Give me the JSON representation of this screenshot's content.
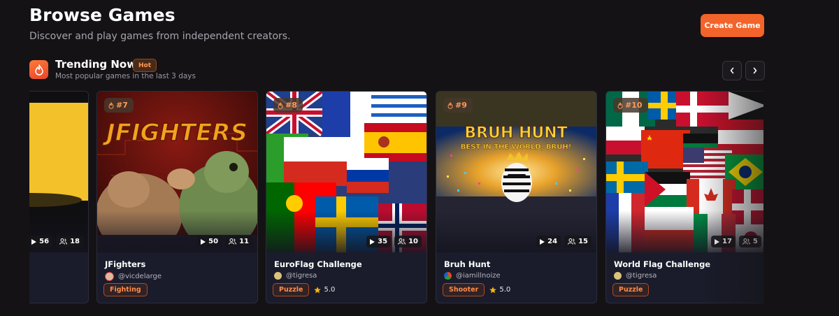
{
  "header": {
    "title": "Browse Games",
    "subtitle": "Discover and play games from independent creators.",
    "create_label": "Create Game"
  },
  "trending": {
    "title": "Trending Now",
    "badge": "Hot",
    "subtitle": "Most popular games in the last 3 days",
    "icon": "flame-icon",
    "prev_icon": "chevron-left-icon",
    "next_icon": "chevron-right-icon"
  },
  "colors": {
    "accent": "#f2642a",
    "background": "#141215",
    "card": "#1a1c2b",
    "tag_text": "#ff8c4a",
    "star": "#f5b50a"
  },
  "cards": [
    {
      "plays": "56",
      "players": "18"
    },
    {
      "rank": "#7",
      "title": "JFighters",
      "author": "@vicdelarge",
      "tag": "Fighting",
      "plays": "50",
      "players": "11"
    },
    {
      "rank": "#8",
      "title": "EuroFlag Challenge",
      "author": "@tigresa",
      "tag": "Puzzle",
      "rating": "5.0",
      "plays": "35",
      "players": "10"
    },
    {
      "rank": "#9",
      "title": "Bruh Hunt",
      "author": "@iamillnoize",
      "tag": "Shooter",
      "rating": "5.0",
      "plays": "24",
      "players": "15"
    },
    {
      "rank": "#10",
      "title": "World Flag Challenge",
      "author": "@tigresa",
      "tag": "Puzzle",
      "plays": "17",
      "players": "5"
    }
  ],
  "thumb_text": {
    "jfighters": "JFIGHTERS",
    "bruh_line1": "BRUH HUNT",
    "bruh_line2": "BEST IN THE WORLD, BRUH!"
  }
}
